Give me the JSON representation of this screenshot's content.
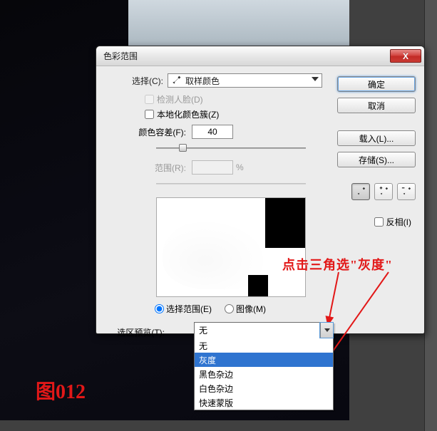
{
  "dialog": {
    "title": "色彩范围",
    "select_label": "选择(C):",
    "select_value": "取样颜色",
    "detect_faces": "检测人脸(D)",
    "localized": "本地化颜色簇(Z)",
    "fuzziness_label": "颜色容差(F):",
    "fuzziness_value": "40",
    "range_label": "范围(R):",
    "range_unit": "%",
    "radio_selection": "选择范围(E)",
    "radio_image": "图像(M)",
    "preview_label": "选区预览(T):",
    "preview_value": "无",
    "buttons": {
      "ok": "确定",
      "cancel": "取消",
      "load": "载入(L)...",
      "save": "存储(S)..."
    },
    "invert": "反相(I)",
    "close_x": "X"
  },
  "dropdown": {
    "display": "无",
    "options": [
      "无",
      "灰度",
      "黑色杂边",
      "白色杂边",
      "快速蒙版"
    ]
  },
  "annotation": {
    "instruction": "点击三角选\"灰度\"",
    "figure": "图012"
  },
  "icons": {
    "eyedropper": "eyedropper-icon",
    "eyedropper_plus": "eyedropper-plus-icon",
    "eyedropper_minus": "eyedropper-minus-icon"
  }
}
